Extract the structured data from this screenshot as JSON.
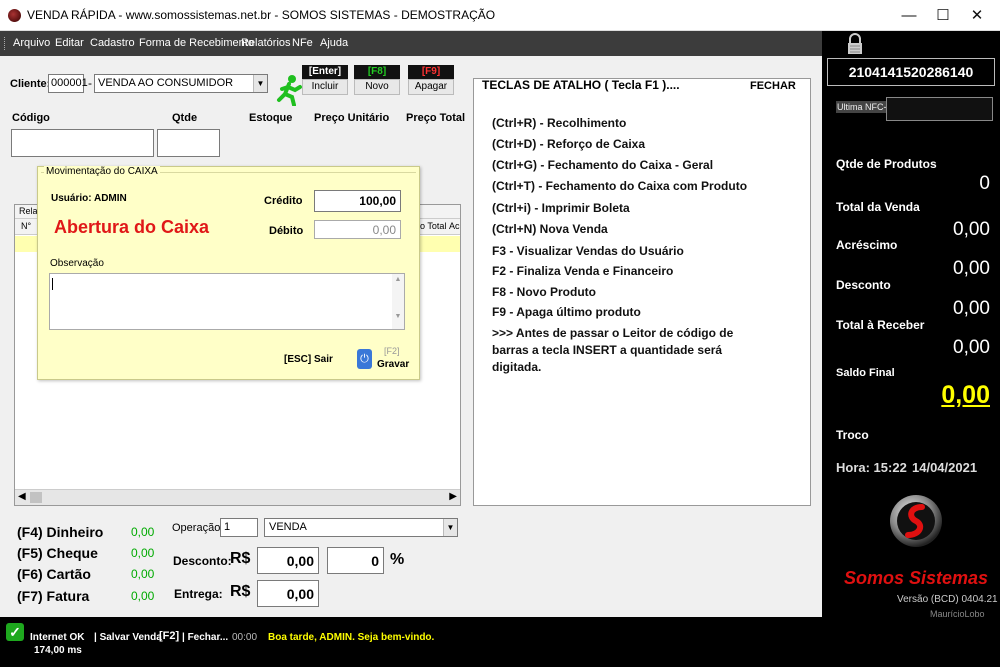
{
  "window": {
    "title": "VENDA RÁPIDA - www.somossistemas.net.br - SOMOS SISTEMAS - DEMOSTRAÇÃO",
    "min": "—",
    "max": "☐",
    "close": "✕"
  },
  "menu": [
    "Arquivo",
    "Editar",
    "Cadastro",
    "Forma de Recebimento",
    "Relatórios",
    "NFe",
    "Ajuda"
  ],
  "client": {
    "label": "Cliente:",
    "code": "000001",
    "dash": "-",
    "name": "VENDA AO CONSUMIDOR"
  },
  "keys": {
    "incluir": {
      "key": "[Enter]",
      "label": "Incluir",
      "color": "#ffffff"
    },
    "novo": {
      "key": "[F8]",
      "label": "Novo",
      "color": "#22cc22"
    },
    "apagar": {
      "key": "[F9]",
      "label": "Apagar",
      "color": "#ff3333"
    }
  },
  "fields": {
    "codigo": "Código",
    "qtde": "Qtde",
    "estoque": "Estoque",
    "preco_unit": "Preço Unitário",
    "preco_total": "Preço Total"
  },
  "table": {
    "rela": "Rela",
    "n": "N°",
    "total_frag": "o Total",
    "ac_frag": "Ac"
  },
  "dialog": {
    "group_title": "Movimentação do CAIXA",
    "usuario": "Usuário: ADMIN",
    "heading": "Abertura do Caixa",
    "credito_label": "Crédito",
    "credito_value": "100,00",
    "debito_label": "Débito",
    "debito_value": "0,00",
    "obs_label": "Observação",
    "sair": "[ESC] Sair",
    "gravar_key": "[F2]",
    "gravar": "Gravar"
  },
  "shortcuts": {
    "title": "TECLAS DE ATALHO ( Tecla F1 )....",
    "close": "FECHAR",
    "lines": [
      "(Ctrl+R) - Recolhimento",
      "(Ctrl+D) - Reforço de Caixa",
      "(Ctrl+G) - Fechamento do Caixa - Geral",
      "(Ctrl+T) - Fechamento do Caixa com Produto",
      "(Ctrl+i) - Imprimir Boleta",
      "(Ctrl+N) Nova Venda",
      "F3 - Visualizar Vendas do Usuário",
      "F2 - Finaliza Venda e Financeiro",
      "F8 - Novo Produto",
      "F9 - Apaga último produto"
    ],
    "note": [
      ">>> Antes de passar o Leitor de código de",
      "barras a tecla INSERT a quantidade será",
      "digitada."
    ]
  },
  "payments": [
    {
      "label": "(F4) Dinheiro",
      "value": "0,00"
    },
    {
      "label": "(F5) Cheque",
      "value": "0,00"
    },
    {
      "label": "(F6) Cartão",
      "value": "0,00"
    },
    {
      "label": "(F7) Fatura",
      "value": "0,00"
    }
  ],
  "operation": {
    "label": "Operação:",
    "code": "1",
    "name": "VENDA"
  },
  "desconto": {
    "label": "Desconto:",
    "currency": "R$",
    "value": "0,00",
    "percent": "0",
    "percent_sign": "%"
  },
  "entrega": {
    "label": "Entrega:",
    "currency": "R$",
    "value": "0,00"
  },
  "right": {
    "serial": "2104141520286140",
    "nfce_label": "Ultima NFC-e",
    "qtde_label": "Qtde de Produtos",
    "qtde_value": "0",
    "total_venda_label": "Total da Venda",
    "total_venda_value": "0,00",
    "acrescimo_label": "Acréscimo",
    "acrescimo_value": "0,00",
    "desconto_label": "Desconto",
    "desconto_value": "0,00",
    "total_receber_label": "Total à Receber",
    "total_receber_value": "0,00",
    "saldo_label": "Saldo Final",
    "saldo_value": "0,00",
    "troco_label": "Troco",
    "hora": "Hora: 15:22",
    "data": "14/04/2021",
    "brand": "Somos Sistemas",
    "versao": "Versão (BCD) 0404.21",
    "author": "MaurícioLobo",
    "saldo_color": "#ffff00",
    "brand_color": "#e01010"
  },
  "status": {
    "internet": "Internet OK",
    "ms": "174,00 ms",
    "salvar": "| Salvar Venda",
    "salvar_key": "[F2]",
    "fechar": "| Fechar...",
    "time": "00:00",
    "greeting": "Boa tarde, ADMIN. Seja bem-vindo."
  }
}
